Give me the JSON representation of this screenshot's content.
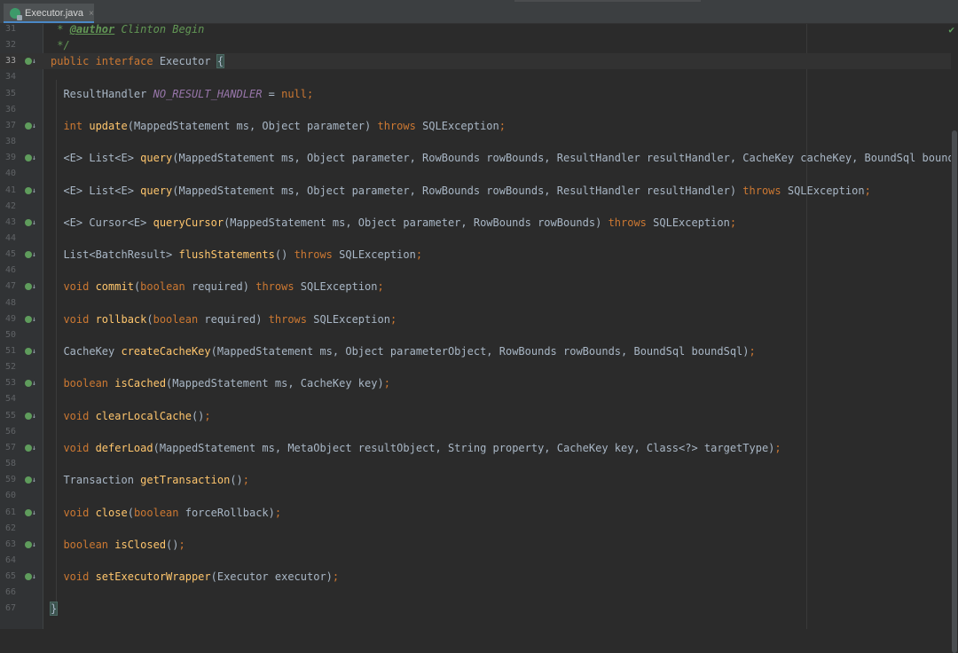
{
  "tab": {
    "label": "Executor.java",
    "close": "×"
  },
  "status": {
    "check": "✔"
  },
  "code_lines": [
    {
      "n": "31",
      "tokens": [
        {
          "t": " * ",
          "c": "cm"
        },
        {
          "t": "@author",
          "c": "tagc"
        },
        {
          "t": " Clinton Begin",
          "c": "cm"
        }
      ]
    },
    {
      "n": "32",
      "tokens": [
        {
          "t": " */",
          "c": "cm"
        }
      ]
    },
    {
      "n": "33",
      "mark": true,
      "current": true,
      "tokens": [
        {
          "t": "public interface ",
          "c": "kw"
        },
        {
          "t": "Executor ",
          "c": ""
        },
        {
          "t": "{",
          "c": "brace"
        }
      ]
    },
    {
      "n": "34",
      "tokens": []
    },
    {
      "n": "35",
      "tokens": [
        {
          "t": "  ResultHandler ",
          "c": ""
        },
        {
          "t": "NO_RESULT_HANDLER",
          "c": "const"
        },
        {
          "t": " = ",
          "c": ""
        },
        {
          "t": "null",
          "c": "kw"
        },
        {
          "t": ";",
          "c": "kw"
        }
      ]
    },
    {
      "n": "36",
      "tokens": []
    },
    {
      "n": "37",
      "mark": true,
      "tokens": [
        {
          "t": "  ",
          "c": ""
        },
        {
          "t": "int ",
          "c": "kw"
        },
        {
          "t": "update",
          "c": "fn"
        },
        {
          "t": "(MappedStatement ms, Object parameter) ",
          "c": ""
        },
        {
          "t": "throws ",
          "c": "kw"
        },
        {
          "t": "SQLException",
          "c": ""
        },
        {
          "t": ";",
          "c": "kw"
        }
      ]
    },
    {
      "n": "38",
      "tokens": []
    },
    {
      "n": "39",
      "mark": true,
      "tokens": [
        {
          "t": "  <E> List<E> ",
          "c": ""
        },
        {
          "t": "query",
          "c": "fn"
        },
        {
          "t": "(MappedStatement ms, Object parameter, RowBounds rowBounds, ResultHandler resultHandler, CacheKey cacheKey, BoundSql boundSql",
          "c": ""
        }
      ]
    },
    {
      "n": "40",
      "tokens": []
    },
    {
      "n": "41",
      "mark": true,
      "tokens": [
        {
          "t": "  <E> List<E> ",
          "c": ""
        },
        {
          "t": "query",
          "c": "fn"
        },
        {
          "t": "(MappedStatement ms, Object parameter, RowBounds rowBounds, ResultHandler resultHandler) ",
          "c": ""
        },
        {
          "t": "throws ",
          "c": "kw"
        },
        {
          "t": "SQLException",
          "c": ""
        },
        {
          "t": ";",
          "c": "kw"
        }
      ]
    },
    {
      "n": "42",
      "tokens": []
    },
    {
      "n": "43",
      "mark": true,
      "tokens": [
        {
          "t": "  <E> Cursor<E> ",
          "c": ""
        },
        {
          "t": "queryCursor",
          "c": "fn"
        },
        {
          "t": "(MappedStatement ms, Object parameter, RowBounds rowBounds) ",
          "c": ""
        },
        {
          "t": "throws ",
          "c": "kw"
        },
        {
          "t": "SQLException",
          "c": ""
        },
        {
          "t": ";",
          "c": "kw"
        }
      ]
    },
    {
      "n": "44",
      "tokens": []
    },
    {
      "n": "45",
      "mark": true,
      "tokens": [
        {
          "t": "  List<BatchResult> ",
          "c": ""
        },
        {
          "t": "flushStatements",
          "c": "fn"
        },
        {
          "t": "() ",
          "c": ""
        },
        {
          "t": "throws ",
          "c": "kw"
        },
        {
          "t": "SQLException",
          "c": ""
        },
        {
          "t": ";",
          "c": "kw"
        }
      ]
    },
    {
      "n": "46",
      "tokens": []
    },
    {
      "n": "47",
      "mark": true,
      "tokens": [
        {
          "t": "  ",
          "c": ""
        },
        {
          "t": "void ",
          "c": "kw"
        },
        {
          "t": "commit",
          "c": "fn"
        },
        {
          "t": "(",
          "c": ""
        },
        {
          "t": "boolean ",
          "c": "kw"
        },
        {
          "t": "required) ",
          "c": ""
        },
        {
          "t": "throws ",
          "c": "kw"
        },
        {
          "t": "SQLException",
          "c": ""
        },
        {
          "t": ";",
          "c": "kw"
        }
      ]
    },
    {
      "n": "48",
      "tokens": []
    },
    {
      "n": "49",
      "mark": true,
      "tokens": [
        {
          "t": "  ",
          "c": ""
        },
        {
          "t": "void ",
          "c": "kw"
        },
        {
          "t": "rollback",
          "c": "fn"
        },
        {
          "t": "(",
          "c": ""
        },
        {
          "t": "boolean ",
          "c": "kw"
        },
        {
          "t": "required) ",
          "c": ""
        },
        {
          "t": "throws ",
          "c": "kw"
        },
        {
          "t": "SQLException",
          "c": ""
        },
        {
          "t": ";",
          "c": "kw"
        }
      ]
    },
    {
      "n": "50",
      "tokens": []
    },
    {
      "n": "51",
      "mark": true,
      "tokens": [
        {
          "t": "  CacheKey ",
          "c": ""
        },
        {
          "t": "createCacheKey",
          "c": "fn"
        },
        {
          "t": "(MappedStatement ms, Object parameterObject, RowBounds rowBounds, BoundSql boundSql)",
          "c": ""
        },
        {
          "t": ";",
          "c": "kw"
        }
      ]
    },
    {
      "n": "52",
      "tokens": []
    },
    {
      "n": "53",
      "mark": true,
      "tokens": [
        {
          "t": "  ",
          "c": ""
        },
        {
          "t": "boolean ",
          "c": "kw"
        },
        {
          "t": "isCached",
          "c": "fn"
        },
        {
          "t": "(MappedStatement ms, CacheKey key)",
          "c": ""
        },
        {
          "t": ";",
          "c": "kw"
        }
      ]
    },
    {
      "n": "54",
      "tokens": []
    },
    {
      "n": "55",
      "mark": true,
      "tokens": [
        {
          "t": "  ",
          "c": ""
        },
        {
          "t": "void ",
          "c": "kw"
        },
        {
          "t": "clearLocalCache",
          "c": "fn"
        },
        {
          "t": "()",
          "c": ""
        },
        {
          "t": ";",
          "c": "kw"
        }
      ]
    },
    {
      "n": "56",
      "tokens": []
    },
    {
      "n": "57",
      "mark": true,
      "tokens": [
        {
          "t": "  ",
          "c": ""
        },
        {
          "t": "void ",
          "c": "kw"
        },
        {
          "t": "deferLoad",
          "c": "fn"
        },
        {
          "t": "(MappedStatement ms, MetaObject resultObject, String property, CacheKey key, Class<?> targetType)",
          "c": ""
        },
        {
          "t": ";",
          "c": "kw"
        }
      ]
    },
    {
      "n": "58",
      "tokens": []
    },
    {
      "n": "59",
      "mark": true,
      "tokens": [
        {
          "t": "  Transaction ",
          "c": ""
        },
        {
          "t": "getTransaction",
          "c": "fn"
        },
        {
          "t": "()",
          "c": ""
        },
        {
          "t": ";",
          "c": "kw"
        }
      ]
    },
    {
      "n": "60",
      "tokens": []
    },
    {
      "n": "61",
      "mark": true,
      "tokens": [
        {
          "t": "  ",
          "c": ""
        },
        {
          "t": "void ",
          "c": "kw"
        },
        {
          "t": "close",
          "c": "fn"
        },
        {
          "t": "(",
          "c": ""
        },
        {
          "t": "boolean ",
          "c": "kw"
        },
        {
          "t": "forceRollback)",
          "c": ""
        },
        {
          "t": ";",
          "c": "kw"
        }
      ]
    },
    {
      "n": "62",
      "tokens": []
    },
    {
      "n": "63",
      "mark": true,
      "tokens": [
        {
          "t": "  ",
          "c": ""
        },
        {
          "t": "boolean ",
          "c": "kw"
        },
        {
          "t": "isClosed",
          "c": "fn"
        },
        {
          "t": "()",
          "c": ""
        },
        {
          "t": ";",
          "c": "kw"
        }
      ]
    },
    {
      "n": "64",
      "tokens": []
    },
    {
      "n": "65",
      "mark": true,
      "tokens": [
        {
          "t": "  ",
          "c": ""
        },
        {
          "t": "void ",
          "c": "kw"
        },
        {
          "t": "setExecutorWrapper",
          "c": "fn"
        },
        {
          "t": "(Executor executor)",
          "c": ""
        },
        {
          "t": ";",
          "c": "kw"
        }
      ]
    },
    {
      "n": "66",
      "tokens": []
    },
    {
      "n": "67",
      "tokens": [
        {
          "t": "}",
          "c": "brace"
        }
      ]
    }
  ]
}
